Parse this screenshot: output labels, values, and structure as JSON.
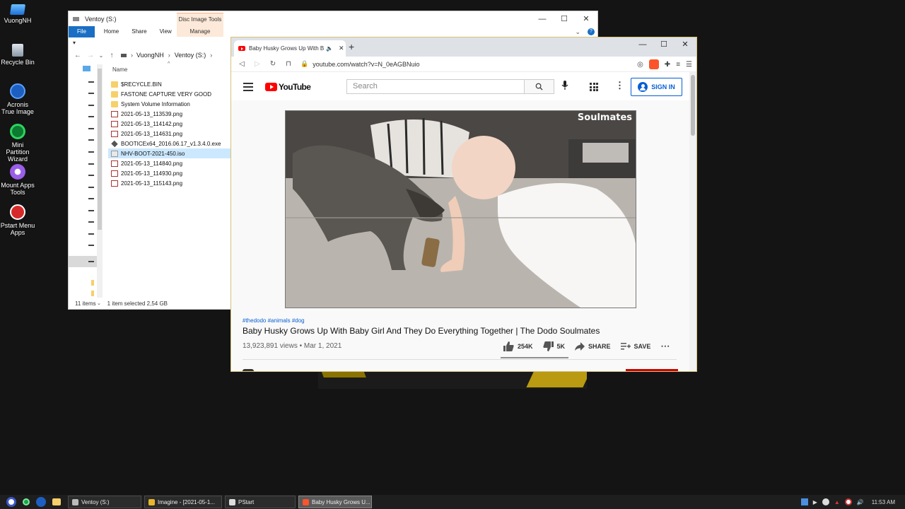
{
  "desktop": {
    "icons": [
      {
        "label": "VuongNH",
        "color": "#3a8fd8"
      },
      {
        "label": "Recycle Bin",
        "color": "#9aa5b1"
      },
      {
        "label": "Acronis True Image",
        "color": "#1c5fc0"
      },
      {
        "label": "Mini Partition Wizard",
        "color": "#1aa34a"
      },
      {
        "label": "Mount Apps Tools",
        "color": "#8a4fd8"
      },
      {
        "label": "Pstart Menu Apps",
        "color": "#d62a2a"
      }
    ]
  },
  "explorer": {
    "title": "Ventoy (S:)",
    "tabs": {
      "file": "File",
      "home": "Home",
      "share": "Share",
      "view": "View"
    },
    "disc_tools": {
      "group": "Disc Image Tools",
      "manage": "Manage"
    },
    "breadcrumb": {
      "root": "VuongNH",
      "drive": "Ventoy (S:)"
    },
    "column_name": "Name",
    "files": [
      {
        "name": "$RECYCLE.BIN",
        "type": "folder"
      },
      {
        "name": "FASTONE CAPTURE VERY GOOD",
        "type": "folder"
      },
      {
        "name": "System Volume Information",
        "type": "folder"
      },
      {
        "name": "2021-05-13_113539.png",
        "type": "png"
      },
      {
        "name": "2021-05-13_114142.png",
        "type": "png"
      },
      {
        "name": "2021-05-13_114631.png",
        "type": "png"
      },
      {
        "name": "BOOTICEx64_2016.06.17_v1.3.4.0.exe",
        "type": "exe"
      },
      {
        "name": "NHV-BOOT-2021-450.iso",
        "type": "iso",
        "selected": true
      },
      {
        "name": "2021-05-13_114840.png",
        "type": "png"
      },
      {
        "name": "2021-05-13_114930.png",
        "type": "png"
      },
      {
        "name": "2021-05-13_115143.png",
        "type": "png"
      }
    ],
    "status": {
      "items": "11 items",
      "selected": "1 item selected  2,54 GB"
    }
  },
  "browser": {
    "tab_title": "Baby Husky Grows Up With Ba",
    "url": "youtube.com/watch?v=N_0eAGBNuio",
    "youtube": {
      "logo": "YouTube",
      "search_placeholder": "Search",
      "sign_in": "SIGN IN",
      "watermark": "Soulmates",
      "tags": "#thedodo #animals #dog",
      "title": "Baby Husky Grows Up With Baby Girl And They Do Everything Together | The Dodo Soulmates",
      "views": "13,923,891 views • Mar 1, 2021",
      "likes": "254K",
      "dislikes": "5K",
      "share": "SHARE",
      "save": "SAVE"
    }
  },
  "taskbar": {
    "tasks": [
      {
        "label": "Ventoy (S:)",
        "color": "#bbb"
      },
      {
        "label": "Imagine - [2021-05-1...",
        "color": "#e8b62c"
      },
      {
        "label": "PStart",
        "color": "#ddd"
      },
      {
        "label": "Baby Husky Grows U...",
        "color": "#fb542b",
        "active": true
      }
    ],
    "clock": "11:53 AM"
  }
}
